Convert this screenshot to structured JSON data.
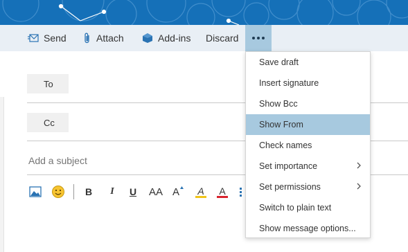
{
  "toolbar": {
    "send_label": "Send",
    "attach_label": "Attach",
    "addins_label": "Add-ins",
    "discard_label": "Discard",
    "more_icon": "more-icon"
  },
  "compose": {
    "to_label": "To",
    "cc_label": "Cc",
    "subject_placeholder": "Add a subject"
  },
  "format_bar": {
    "bold": "B",
    "italic": "I",
    "underline": "U",
    "font_size": "AA",
    "grow_font": "A",
    "highlight": "A",
    "font_color": "A",
    "icons": [
      "insert-picture-icon",
      "emoji-icon",
      "bullets-icon"
    ]
  },
  "more_menu": {
    "items": [
      {
        "label": "Save draft",
        "submenu": false
      },
      {
        "label": "Insert signature",
        "submenu": false
      },
      {
        "label": "Show Bcc",
        "submenu": false
      },
      {
        "label": "Show From",
        "submenu": false,
        "highlighted": true
      },
      {
        "label": "Check names",
        "submenu": false
      },
      {
        "label": "Set importance",
        "submenu": true
      },
      {
        "label": "Set permissions",
        "submenu": true
      },
      {
        "label": "Switch to plain text",
        "submenu": false
      },
      {
        "label": "Show message options...",
        "submenu": false
      }
    ]
  },
  "colors": {
    "header": "#1570b8",
    "toolbar": "#e9eff5",
    "highlight": "#a7c9df",
    "highlight_bar": "#f0c419",
    "font_color_bar": "#d9232e"
  }
}
